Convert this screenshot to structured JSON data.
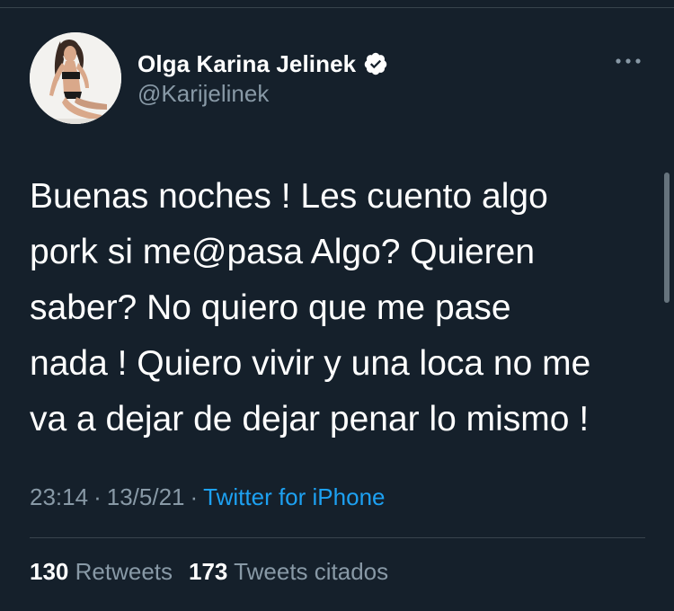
{
  "author": {
    "display_name": "Olga Karina Jelinek",
    "handle": "@Karijelinek",
    "verified": true,
    "avatar_icon": "profile-photo"
  },
  "tweet": {
    "text": "Buenas noches ! Les cuento algo\npork si me@pasa Algo? Quieren\nsaber? No  quiero que me pase\nnada ! Quiero vivir y una loca no me\nva a dejar de dejar penar lo mismo !",
    "time": "23:14",
    "date": "13/5/21",
    "separator": "·",
    "source": "Twitter for iPhone"
  },
  "stats": {
    "retweets_count": "130",
    "retweets_label": "Retweets",
    "quotes_count": "173",
    "quotes_label": "Tweets citados"
  },
  "colors": {
    "background": "#15202b",
    "text_secondary": "#8899a6",
    "accent": "#1da1f2",
    "divider": "#38444d"
  },
  "icons": {
    "more": "more-horizontal-icon",
    "verified": "verified-badge-icon"
  }
}
